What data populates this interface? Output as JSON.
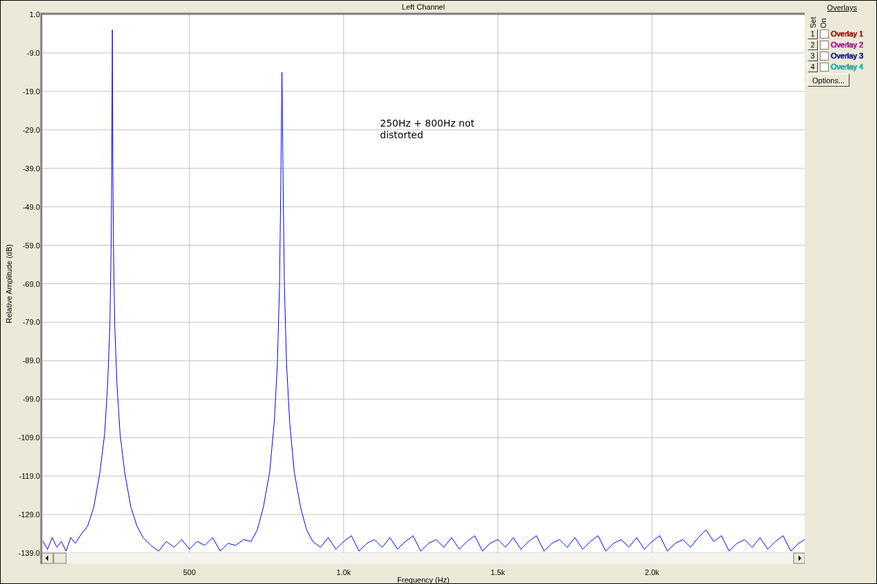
{
  "window": {
    "title": "Left Channel"
  },
  "chart": {
    "chart_data": {
      "type": "line",
      "xlabel": "Frequency (Hz)",
      "ylabel": "Relative Amplitude (dB)",
      "x": [
        25,
        40,
        55,
        70,
        85,
        100,
        115,
        130,
        150,
        170,
        190,
        210,
        225,
        235,
        242,
        246,
        248,
        250,
        252,
        254,
        258,
        265,
        275,
        290,
        310,
        330,
        350,
        375,
        400,
        425,
        450,
        475,
        500,
        525,
        550,
        575,
        600,
        625,
        650,
        675,
        700,
        720,
        740,
        760,
        775,
        785,
        792,
        796,
        800,
        804,
        808,
        815,
        825,
        840,
        860,
        880,
        900,
        925,
        950,
        975,
        1000,
        1025,
        1050,
        1075,
        1100,
        1125,
        1150,
        1175,
        1200,
        1225,
        1250,
        1275,
        1300,
        1325,
        1350,
        1375,
        1400,
        1425,
        1450,
        1475,
        1500,
        1525,
        1550,
        1575,
        1600,
        1625,
        1650,
        1675,
        1700,
        1725,
        1750,
        1775,
        1800,
        1825,
        1850,
        1875,
        1900,
        1925,
        1950,
        1975,
        2000,
        2025,
        2050,
        2075,
        2100,
        2125,
        2150,
        2175,
        2200,
        2225,
        2250,
        2275,
        2300,
        2325,
        2350,
        2375,
        2400,
        2425,
        2450,
        2475,
        2495
      ],
      "series": [
        {
          "color": "#0000ff",
          "values": [
            -136,
            -138,
            -135,
            -137.5,
            -136,
            -138.5,
            -135,
            -136.5,
            -134,
            -132,
            -127,
            -118,
            -108,
            -95,
            -80,
            -60,
            -40,
            -3,
            -40,
            -60,
            -80,
            -95,
            -108,
            -118,
            -127,
            -132,
            -135,
            -137,
            -138.5,
            -136,
            -137.5,
            -135.5,
            -138,
            -136,
            -137,
            -135,
            -138.5,
            -136.5,
            -137,
            -135.5,
            -136,
            -133,
            -127,
            -118,
            -105,
            -90,
            -70,
            -45,
            -14,
            -45,
            -70,
            -90,
            -105,
            -118,
            -127,
            -133,
            -136,
            -137.5,
            -135,
            -138,
            -136,
            -134.5,
            -138.5,
            -136.5,
            -135.5,
            -137.5,
            -135,
            -138,
            -136,
            -134.5,
            -138.5,
            -136.5,
            -135.5,
            -137.5,
            -135,
            -138,
            -136,
            -134.5,
            -138.5,
            -136.5,
            -135.5,
            -137.5,
            -135,
            -138,
            -136,
            -134.5,
            -138.5,
            -136.5,
            -135.5,
            -137.5,
            -135,
            -138,
            -136,
            -134.5,
            -138.5,
            -136.5,
            -135.5,
            -137.5,
            -135,
            -138,
            -136,
            -134.5,
            -138.5,
            -136.5,
            -135.5,
            -137.5,
            -135,
            -133,
            -136,
            -134.5,
            -138.5,
            -136.5,
            -135.5,
            -137.5,
            -135,
            -138,
            -136,
            -134.5,
            -138.5,
            -136.5,
            -135.5
          ]
        }
      ],
      "xlim": [
        22,
        2495
      ],
      "ylim": [
        -139,
        1
      ],
      "xticks": [
        {
          "value": 500,
          "label": "500"
        },
        {
          "value": 1000,
          "label": "1.0k"
        },
        {
          "value": 1500,
          "label": "1.5k"
        },
        {
          "value": 2000,
          "label": "2.0k"
        }
      ],
      "yticks": [
        {
          "value": 1,
          "label": "1.0"
        },
        {
          "value": -9,
          "label": "-9.0"
        },
        {
          "value": -19,
          "label": "-19.0"
        },
        {
          "value": -29,
          "label": "-29.0"
        },
        {
          "value": -39,
          "label": "-39.0"
        },
        {
          "value": -49,
          "label": "-49.0"
        },
        {
          "value": -59,
          "label": "-59.0"
        },
        {
          "value": -69,
          "label": "-69.0"
        },
        {
          "value": -79,
          "label": "-79.0"
        },
        {
          "value": -89,
          "label": "-89.0"
        },
        {
          "value": -99,
          "label": "-99.0"
        },
        {
          "value": -109,
          "label": "-109.0"
        },
        {
          "value": -119,
          "label": "-119.0"
        },
        {
          "value": -129,
          "label": "-129.0"
        },
        {
          "value": -139,
          "label": "-139.0"
        }
      ],
      "grid": true,
      "annotations": [
        "250Hz + 800Hz not distorted"
      ]
    }
  },
  "overlays": {
    "title": "Overlays",
    "set_label": "Set",
    "on_label": "On",
    "items": [
      {
        "number": "1",
        "label": "Overlay 1",
        "checked": false,
        "color": "#ff0000"
      },
      {
        "number": "2",
        "label": "Overlay 2",
        "checked": false,
        "color": "#ff00ff"
      },
      {
        "number": "3",
        "label": "Overlay 3",
        "checked": false,
        "color": "#0000ff"
      },
      {
        "number": "4",
        "label": "Overlay 4",
        "checked": false,
        "color": "#00ffff"
      }
    ],
    "options_button": "Options..."
  }
}
